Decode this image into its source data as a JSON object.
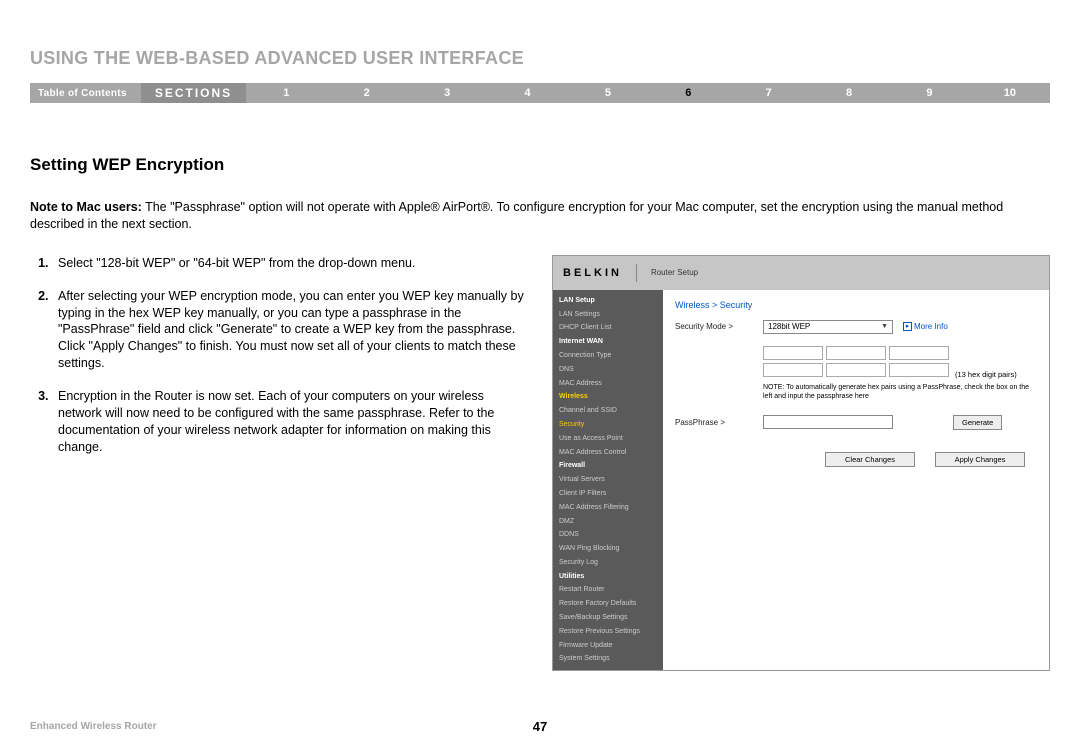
{
  "header": {
    "title": "USING THE WEB-BASED ADVANCED USER INTERFACE",
    "toc_label": "Table of Contents",
    "sections_label": "SECTIONS",
    "numbers": [
      "1",
      "2",
      "3",
      "4",
      "5",
      "6",
      "7",
      "8",
      "9",
      "10"
    ],
    "active_index": 5
  },
  "section": {
    "heading": "Setting WEP Encryption",
    "note_label": "Note to Mac users:",
    "note_body": " The \"Passphrase\" option will not operate with Apple® AirPort®. To configure encryption for your Mac computer, set the encryption using the manual method described in the next section.",
    "steps": [
      "Select \"128-bit WEP\" or \"64-bit WEP\" from the drop-down menu.",
      "After selecting your WEP encryption mode, you can enter you WEP key manually by typing in the hex WEP key manually, or you can type a passphrase in the \"PassPhrase\" field and click \"Generate\" to create a WEP key from the passphrase. Click \"Apply Changes\" to finish. You must now set all of your clients to match these settings.",
      "Encryption in the Router is now set. Each of your computers on your wireless network will now need to be configured with the same passphrase. Refer to the documentation of your wireless network adapter for information on making this change."
    ]
  },
  "router": {
    "brand": "BELKIN",
    "title": "Router Setup",
    "sidebar": [
      {
        "label": "LAN Setup",
        "type": "head"
      },
      {
        "label": "LAN Settings",
        "type": "item"
      },
      {
        "label": "DHCP Client List",
        "type": "item"
      },
      {
        "label": "Internet WAN",
        "type": "head"
      },
      {
        "label": "Connection Type",
        "type": "item"
      },
      {
        "label": "DNS",
        "type": "item"
      },
      {
        "label": "MAC Address",
        "type": "item"
      },
      {
        "label": "Wireless",
        "type": "head-active"
      },
      {
        "label": "Channel and SSID",
        "type": "item"
      },
      {
        "label": "Security",
        "type": "active"
      },
      {
        "label": "Use as Access Point",
        "type": "item"
      },
      {
        "label": "MAC Address Control",
        "type": "item"
      },
      {
        "label": "Firewall",
        "type": "head"
      },
      {
        "label": "Virtual Servers",
        "type": "item"
      },
      {
        "label": "Client IP Filters",
        "type": "item"
      },
      {
        "label": "MAC Address Filtering",
        "type": "item"
      },
      {
        "label": "DMZ",
        "type": "item"
      },
      {
        "label": "DDNS",
        "type": "item"
      },
      {
        "label": "WAN Ping Blocking",
        "type": "item"
      },
      {
        "label": "Security Log",
        "type": "item"
      },
      {
        "label": "Utilities",
        "type": "head"
      },
      {
        "label": "Restart Router",
        "type": "item"
      },
      {
        "label": "Restore Factory Defaults",
        "type": "item"
      },
      {
        "label": "Save/Backup Settings",
        "type": "item"
      },
      {
        "label": "Restore Previous Settings",
        "type": "item"
      },
      {
        "label": "Firmware Update",
        "type": "item"
      },
      {
        "label": "System Settings",
        "type": "item"
      }
    ],
    "breadcrumb": "Wireless > Security",
    "security_mode_label": "Security Mode >",
    "security_mode_value": "128bit WEP",
    "more_info": "More Info",
    "hex_pairs_note": "(13 hex digit pairs)",
    "auto_note": "NOTE: To automatically generate hex pairs using a PassPhrase, check the box on the left and input the passphrase here",
    "passphrase_label": "PassPhrase >",
    "generate_btn": "Generate",
    "clear_btn": "Clear Changes",
    "apply_btn": "Apply Changes"
  },
  "footer": {
    "product": "Enhanced Wireless Router",
    "page": "47"
  }
}
